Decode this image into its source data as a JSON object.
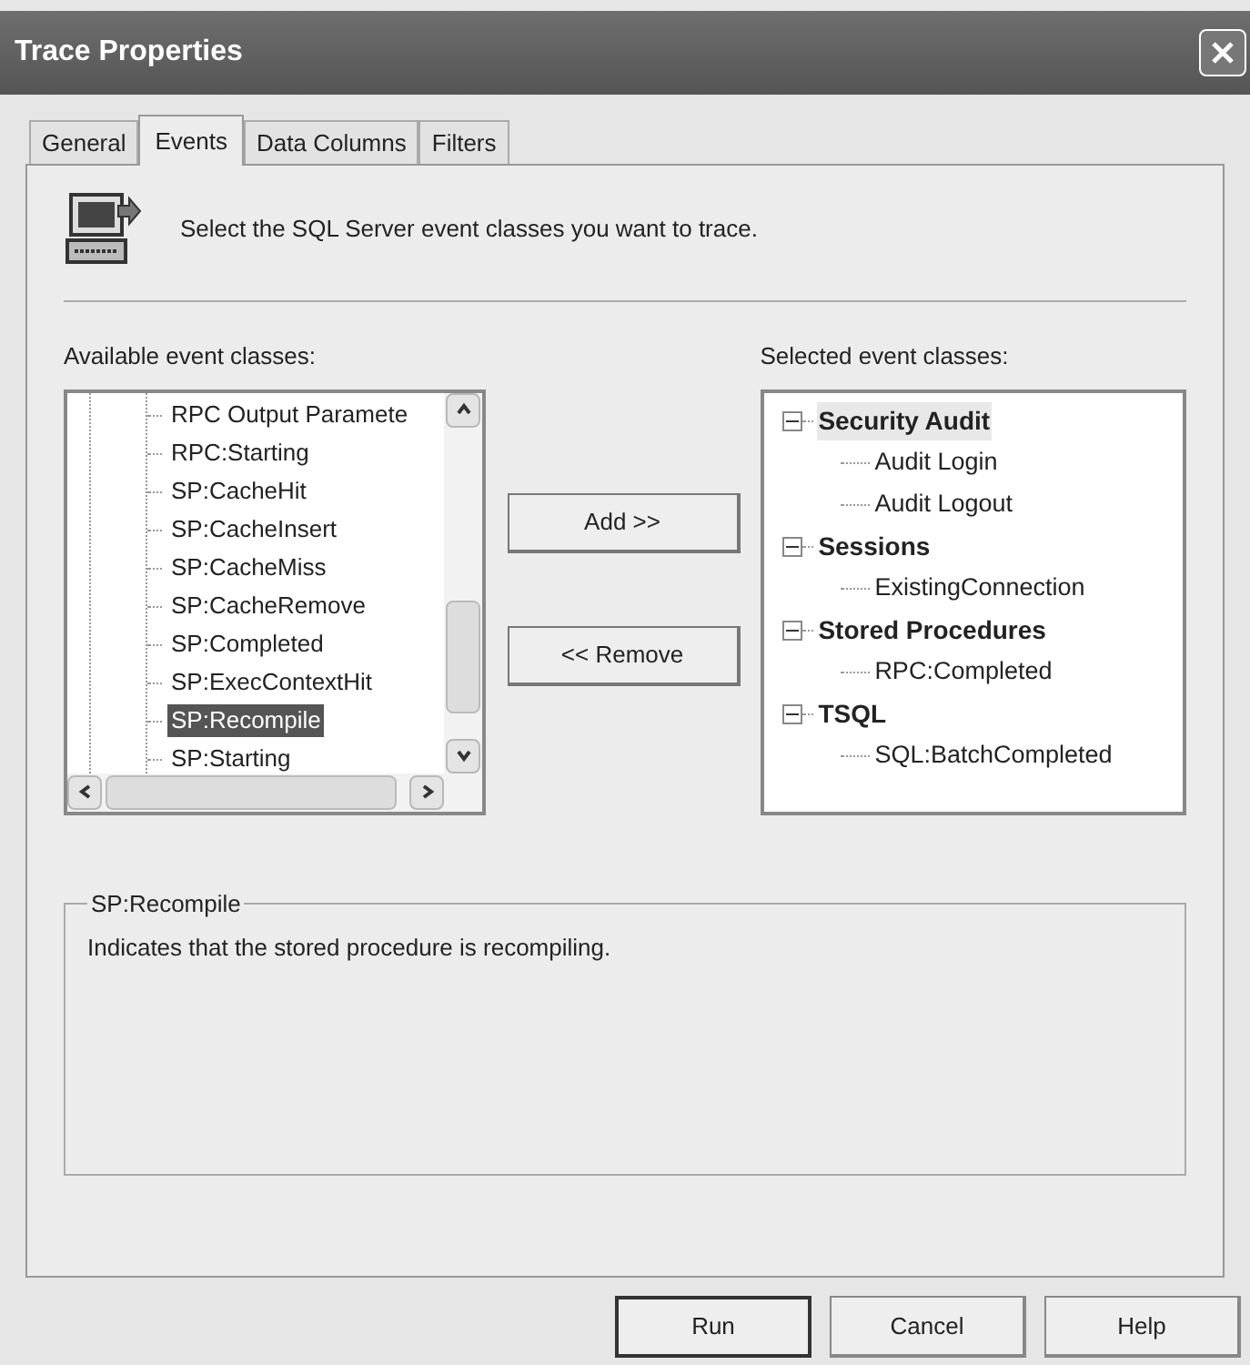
{
  "window": {
    "title": "Trace Properties"
  },
  "tabs": [
    {
      "label": "General",
      "selected": false
    },
    {
      "label": "Events",
      "selected": true
    },
    {
      "label": "Data Columns",
      "selected": false
    },
    {
      "label": "Filters",
      "selected": false
    }
  ],
  "intro": "Select the SQL Server event classes you want to trace.",
  "available": {
    "label": "Available event classes:",
    "items": [
      {
        "label": "RPC Output Paramete",
        "selected": false
      },
      {
        "label": "RPC:Starting",
        "selected": false
      },
      {
        "label": "SP:CacheHit",
        "selected": false
      },
      {
        "label": "SP:CacheInsert",
        "selected": false
      },
      {
        "label": "SP:CacheMiss",
        "selected": false
      },
      {
        "label": "SP:CacheRemove",
        "selected": false
      },
      {
        "label": "SP:Completed",
        "selected": false
      },
      {
        "label": "SP:ExecContextHit",
        "selected": false
      },
      {
        "label": "SP:Recompile",
        "selected": true
      },
      {
        "label": "SP:Starting",
        "selected": false
      }
    ]
  },
  "add_button": "Add >>",
  "remove_button": "<< Remove",
  "selected": {
    "label": "Selected event classes:",
    "items": [
      {
        "label": "Security Audit",
        "expanded": true,
        "selected": true,
        "children": [
          {
            "label": "Audit Login",
            "selected": false
          },
          {
            "label": "Audit Logout",
            "selected": false
          }
        ]
      },
      {
        "label": "Sessions",
        "expanded": true,
        "selected": false,
        "children": [
          {
            "label": "ExistingConnection",
            "selected": false
          }
        ]
      },
      {
        "label": "Stored Procedures",
        "expanded": true,
        "selected": false,
        "children": [
          {
            "label": "RPC:Completed",
            "selected": false
          }
        ]
      },
      {
        "label": "TSQL",
        "expanded": true,
        "selected": false,
        "children": [
          {
            "label": "SQL:BatchCompleted",
            "selected": false
          }
        ]
      }
    ]
  },
  "description": {
    "title": "SP:Recompile",
    "text": "Indicates that the stored procedure is recompiling."
  },
  "buttons": [
    "Run",
    "Cancel",
    "Help"
  ]
}
